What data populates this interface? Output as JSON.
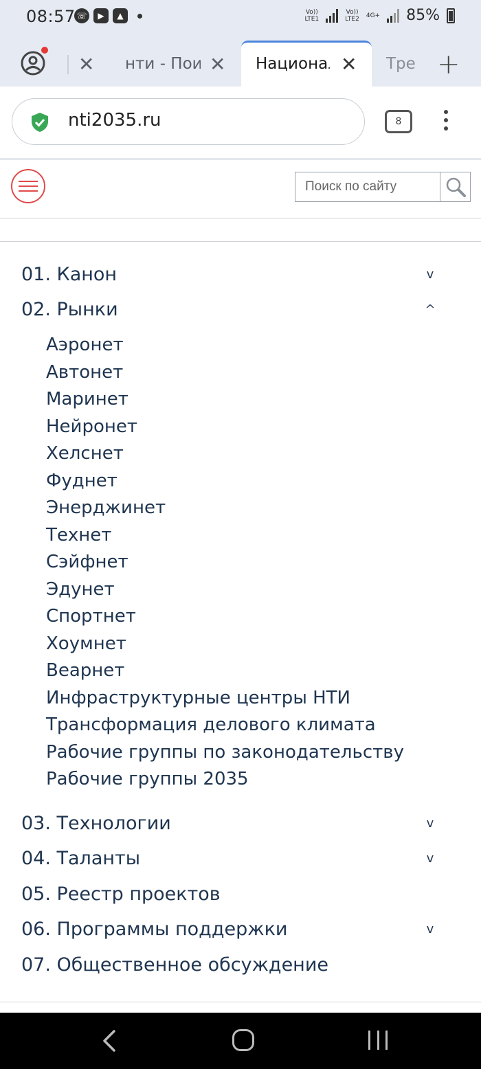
{
  "status_bar": {
    "time": "08:57",
    "sim1_label": "Vo))\nLTE1",
    "sim2_label": "Vo))\nLTE2",
    "network": "4G+",
    "battery": "85%"
  },
  "tabs": {
    "tab2_label": "нти - Пои",
    "active_label": "Национал",
    "tab4_label": "Тре"
  },
  "address_bar": {
    "url": "nti2035.ru",
    "tab_count": "8"
  },
  "site_header": {
    "search_placeholder": "Поиск по сайту"
  },
  "menu": {
    "items": [
      {
        "label": "01. Канон",
        "chevron": "v"
      },
      {
        "label": "02. Рынки",
        "chevron": "^"
      },
      {
        "label": "03. Технологии",
        "chevron": "v"
      },
      {
        "label": "04. Таланты",
        "chevron": "v"
      },
      {
        "label": "05. Реестр проектов",
        "chevron": ""
      },
      {
        "label": "06. Программы поддержки",
        "chevron": "v"
      },
      {
        "label": "07. Общественное обсуждение",
        "chevron": ""
      }
    ],
    "markets_submenu": [
      "Аэронет",
      "Автонет",
      "Маринет",
      "Нейронет",
      "Хелснет",
      "Фуднет",
      "Энерджинет",
      "Технет",
      "Сэйфнет",
      "Эдунет",
      "Спортнет",
      "Хоумнет",
      "Веарнет",
      "Инфраструктурные центры НТИ",
      "Трансформация делового климата",
      "Рабочие группы по законодательству",
      "Рабочие группы 2035"
    ]
  },
  "colors": {
    "accent_red": "#e04a4a",
    "menu_text": "#1f3550",
    "active_tab_border": "#4b84db",
    "secure_shield": "#3aa757"
  }
}
